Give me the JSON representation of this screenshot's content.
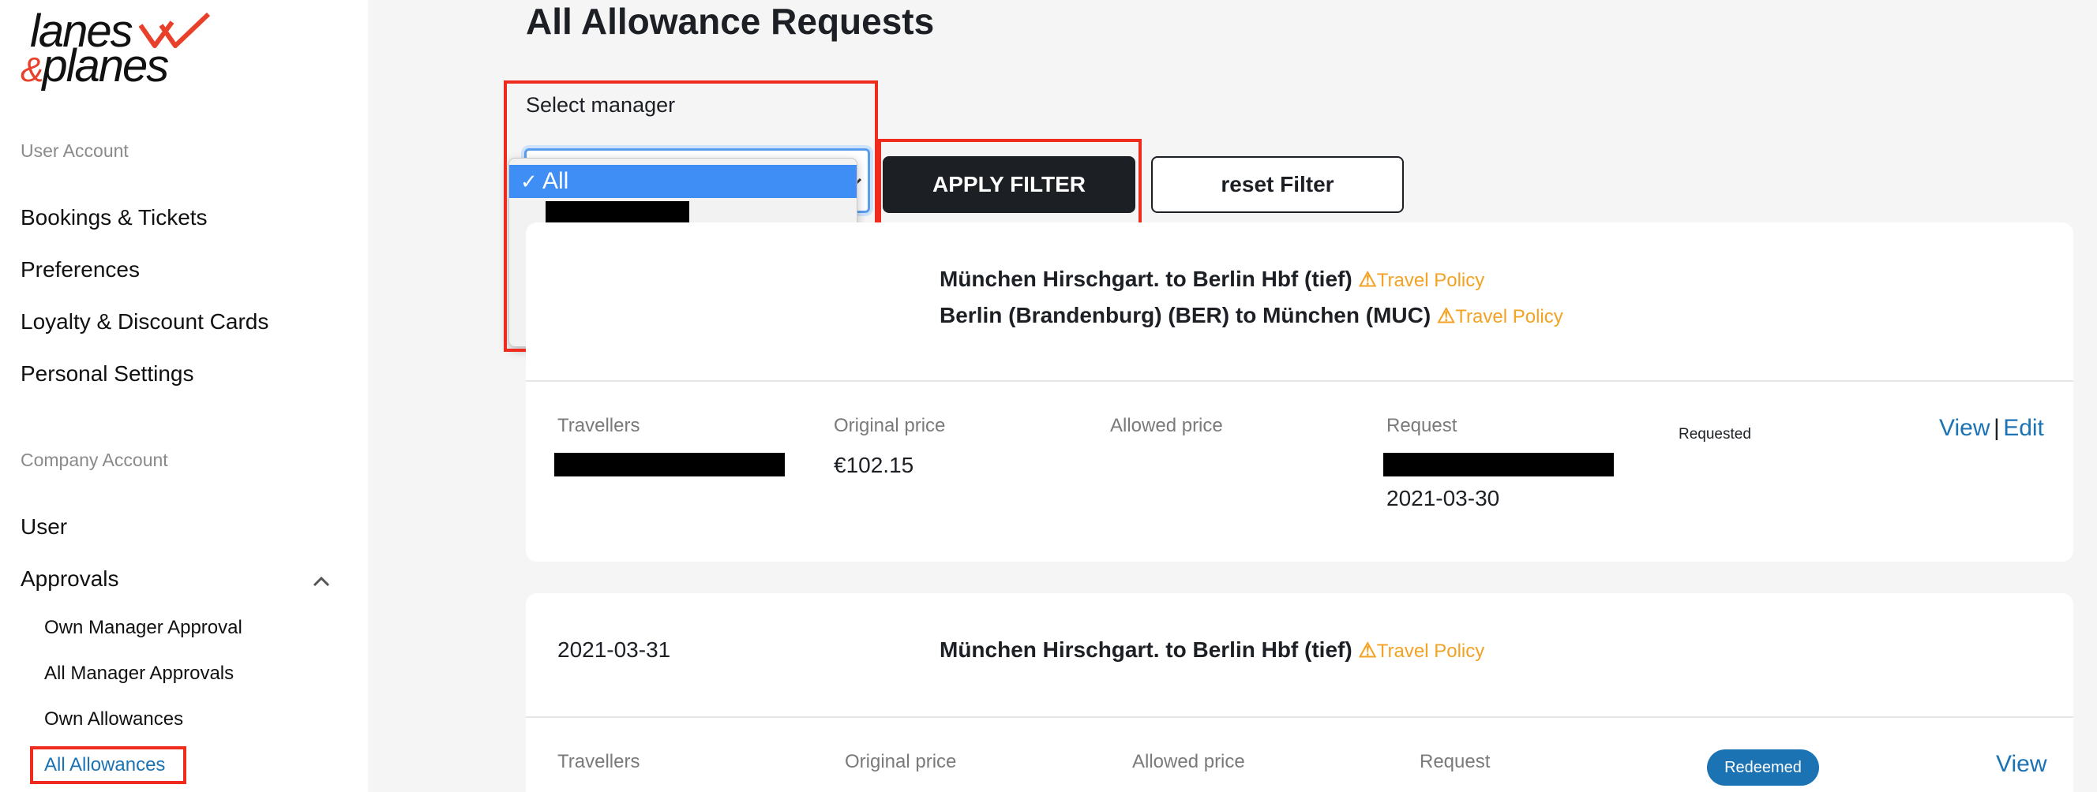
{
  "brand": {
    "line1": "lanes",
    "amp": "&",
    "line2": "planes",
    "accent": "#e8402a"
  },
  "sidebar": {
    "user_account_label": "User Account",
    "user_items": [
      "Bookings & Tickets",
      "Preferences",
      "Loyalty & Discount Cards",
      "Personal Settings"
    ],
    "company_account_label": "Company Account",
    "company_items": [
      "User",
      "Approvals"
    ],
    "approvals_sub": [
      "Own Manager Approval",
      "All Manager Approvals",
      "Own Allowances",
      "All Allowances"
    ]
  },
  "page": {
    "title": "All Allowance Requests"
  },
  "filter": {
    "label": "Select manager",
    "selected": "All",
    "check": "✓",
    "apply": "APPLY FILTER",
    "reset": "reset Filter"
  },
  "cards": [
    {
      "routes": [
        {
          "text": "München Hirschgart. to Berlin Hbf (tief)",
          "policy": "Travel Policy"
        },
        {
          "text": "Berlin (Brandenburg) (BER) to München (MUC)",
          "policy": "Travel Policy"
        }
      ],
      "columns": {
        "travellers": "Travellers",
        "original": "Original price",
        "allowed": "Allowed price",
        "request": "Request"
      },
      "original_price": "€102.15",
      "request_date": "2021-03-30",
      "status": "Requested",
      "actions": {
        "view": "View",
        "separator": "|",
        "edit": "Edit"
      }
    },
    {
      "date": "2021-03-31",
      "routes": [
        {
          "text": "München Hirschgart. to Berlin Hbf (tief)",
          "policy": "Travel Policy"
        }
      ],
      "columns": {
        "travellers": "Travellers",
        "original": "Original price",
        "allowed": "Allowed price",
        "request": "Request"
      },
      "status": "Redeemed",
      "actions": {
        "view": "View"
      }
    }
  ],
  "colors": {
    "link": "#1c73b4",
    "warning": "#f4a223",
    "highlight": "#ef2b1e",
    "primary_button": "#1c1f24"
  }
}
